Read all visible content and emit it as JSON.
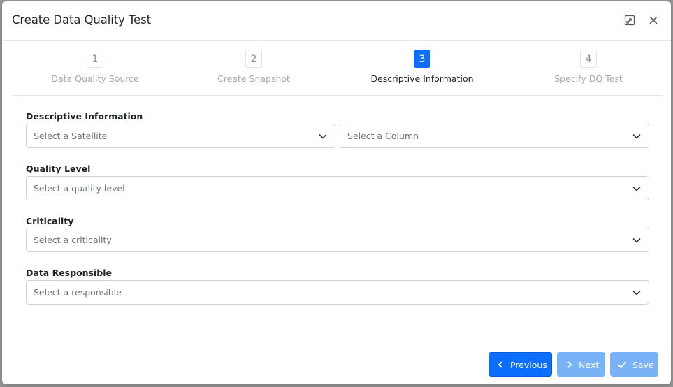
{
  "modal": {
    "title": "Create Data Quality Test",
    "expand_icon": "expand-icon",
    "close_icon": "close-icon"
  },
  "stepper": {
    "active_step": 3,
    "steps": [
      {
        "number": "1",
        "label": "Data Quality Source"
      },
      {
        "number": "2",
        "label": "Create Snapshot"
      },
      {
        "number": "3",
        "label": "Descriptive Information"
      },
      {
        "number": "4",
        "label": "Specify DQ Test"
      }
    ]
  },
  "form": {
    "descriptive_information": {
      "label": "Descriptive Information",
      "satellite_placeholder": "Select a Satellite",
      "column_placeholder": "Select a Column"
    },
    "quality_level": {
      "label": "Quality Level",
      "placeholder": "Select a quality level"
    },
    "criticality": {
      "label": "Criticality",
      "placeholder": "Select a criticality"
    },
    "data_responsible": {
      "label": "Data Responsible",
      "placeholder": "Select a responsible"
    }
  },
  "footer": {
    "previous_label": "Previous",
    "next_label": "Next",
    "save_label": "Save"
  },
  "colors": {
    "primary": "#0d6efd",
    "primary_disabled": "#7ab2f8",
    "backdrop": "#9a9a9a"
  }
}
